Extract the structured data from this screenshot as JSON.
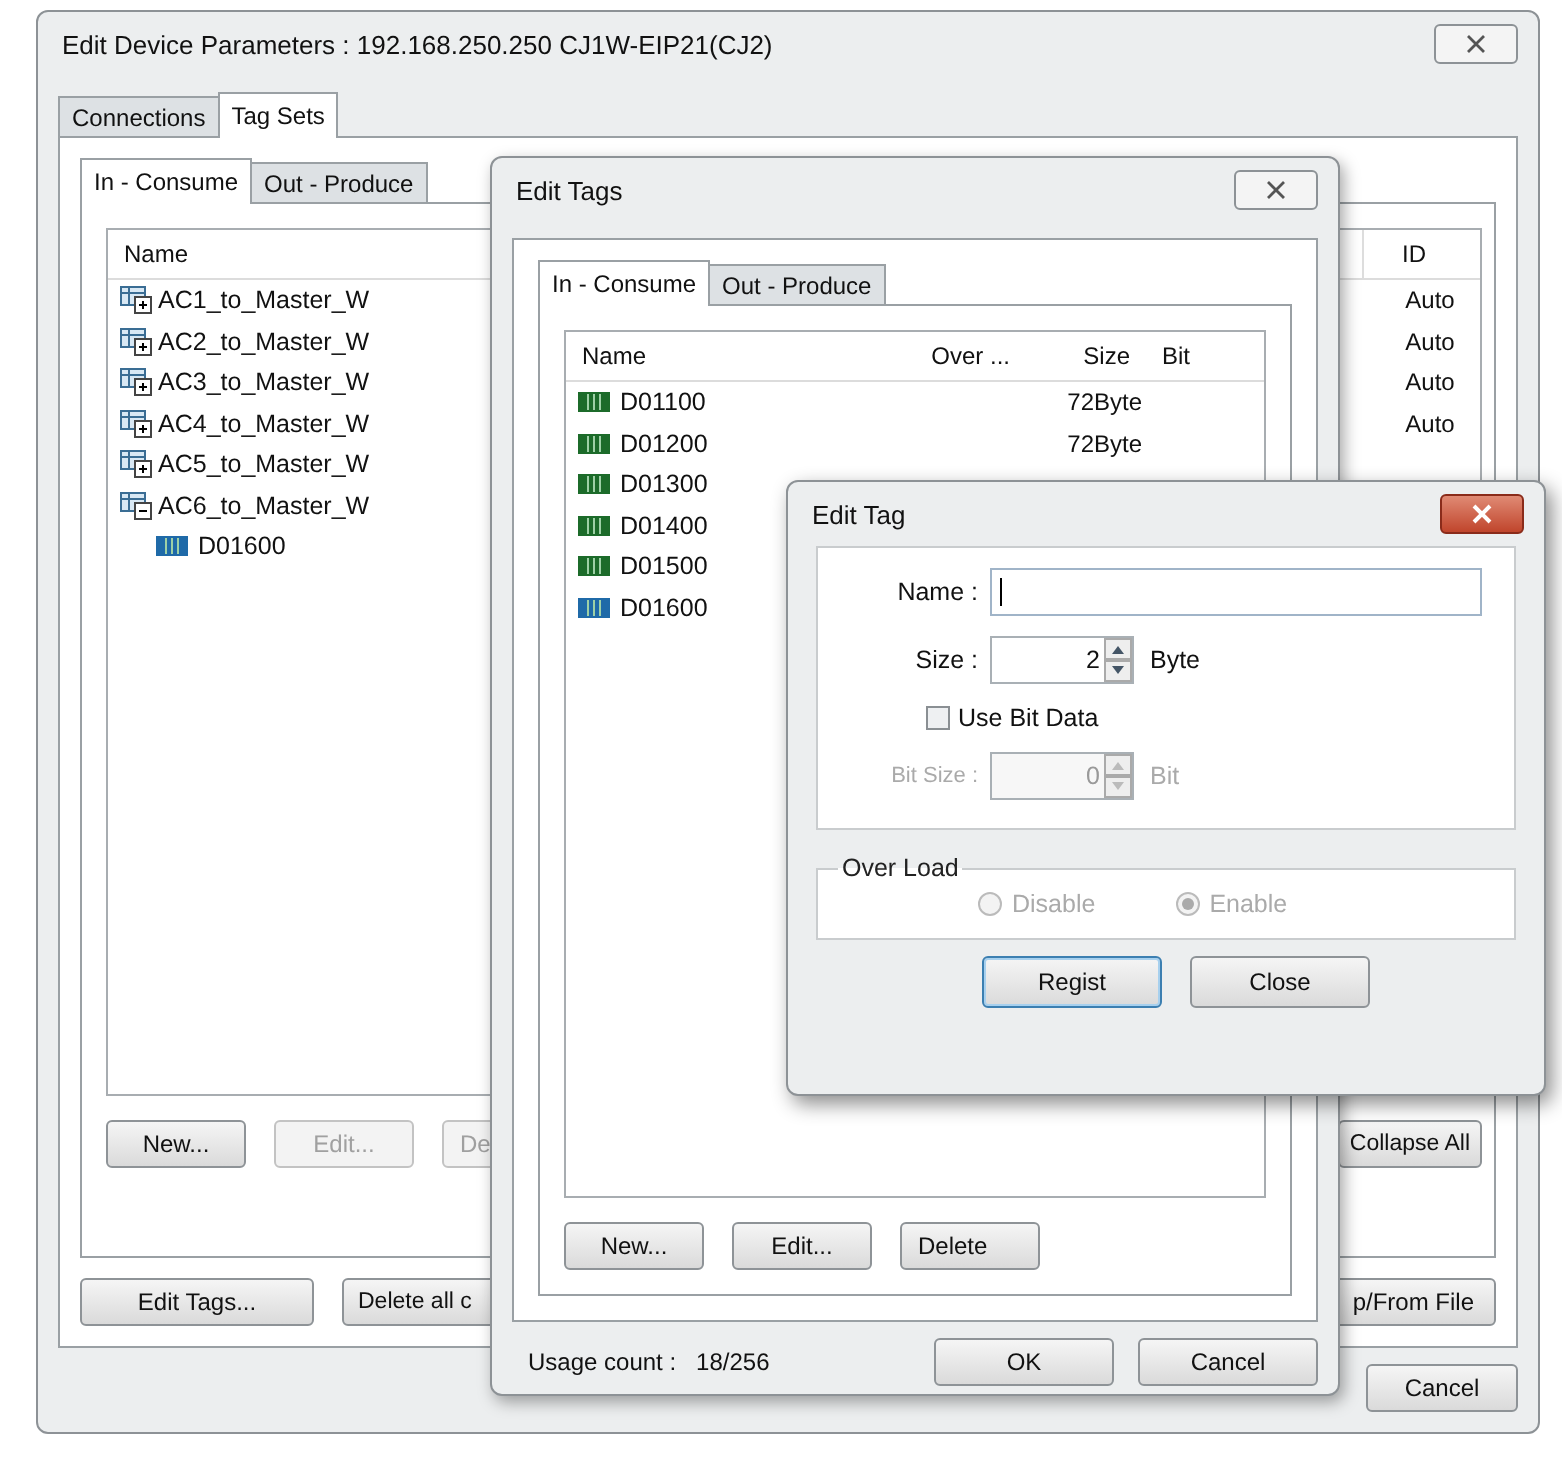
{
  "main_window": {
    "title": "Edit Device Parameters : 192.168.250.250 CJ1W-EIP21(CJ2)",
    "tabs": [
      {
        "label": "Connections",
        "selected": false
      },
      {
        "label": "Tag Sets",
        "selected": true
      }
    ],
    "subtabs": [
      {
        "label": "In - Consume",
        "selected": true
      },
      {
        "label": "Out - Produce",
        "selected": false
      }
    ],
    "columns": [
      "Name",
      "ID"
    ],
    "tree": [
      {
        "name": "AC1_to_Master_W",
        "id": "Auto",
        "expanded": false
      },
      {
        "name": "AC2_to_Master_W",
        "id": "Auto",
        "expanded": false
      },
      {
        "name": "AC3_to_Master_W",
        "id": "Auto",
        "expanded": false
      },
      {
        "name": "AC4_to_Master_W",
        "id": "Auto",
        "expanded": false
      },
      {
        "name": "AC5_to_Master_W",
        "expanded": false
      },
      {
        "name": "AC6_to_Master_W",
        "expanded": true,
        "children": [
          {
            "name": "D01600",
            "color": "#1f6aa8"
          }
        ]
      }
    ],
    "list_buttons": [
      {
        "label": "New...",
        "disabled": false
      },
      {
        "label": "Edit...",
        "disabled": true
      },
      {
        "label": "De",
        "disabled": true
      }
    ],
    "collapse_button": "Collapse All",
    "bottom_buttons": [
      "Edit Tags...",
      "Delete all c"
    ],
    "file_button": "p/From File",
    "cancel_button": "Cancel"
  },
  "edit_tags": {
    "title": "Edit Tags",
    "tabs": [
      {
        "label": "In - Consume",
        "selected": true
      },
      {
        "label": "Out - Produce",
        "selected": false
      }
    ],
    "columns": [
      "Name",
      "Over ...",
      "Size",
      "Bit"
    ],
    "rows": [
      {
        "name": "D01100",
        "size": "72Byte",
        "color": "#1c6b2a"
      },
      {
        "name": "D01200",
        "size": "72Byte",
        "color": "#1c6b2a"
      },
      {
        "name": "D01300",
        "color": "#1c6b2a"
      },
      {
        "name": "D01400",
        "color": "#1c6b2a"
      },
      {
        "name": "D01500",
        "color": "#1c6b2a"
      },
      {
        "name": "D01600",
        "color": "#1f6aa8"
      }
    ],
    "buttons": [
      "New...",
      "Edit...",
      "Delete"
    ],
    "usage_label": "Usage count :",
    "usage": "18/256",
    "ok_button": "OK",
    "cancel_button": "Cancel"
  },
  "edit_tag": {
    "title": "Edit Tag",
    "name_label": "Name :",
    "size_label": "Size :",
    "size_value": "2",
    "size_unit": "Byte",
    "use_bit": {
      "label": "Use Bit Data",
      "checked": false
    },
    "bit_size": {
      "label": "Bit Size :",
      "value": "0",
      "unit": "Bit",
      "disabled": true
    },
    "overload": {
      "label": "Over Load",
      "disabled": true,
      "options": [
        {
          "label": "Disable",
          "selected": false
        },
        {
          "label": "Enable",
          "selected": true
        }
      ]
    },
    "buttons": [
      {
        "label": "Regist",
        "default": true
      },
      {
        "label": "Close",
        "default": false
      }
    ]
  }
}
